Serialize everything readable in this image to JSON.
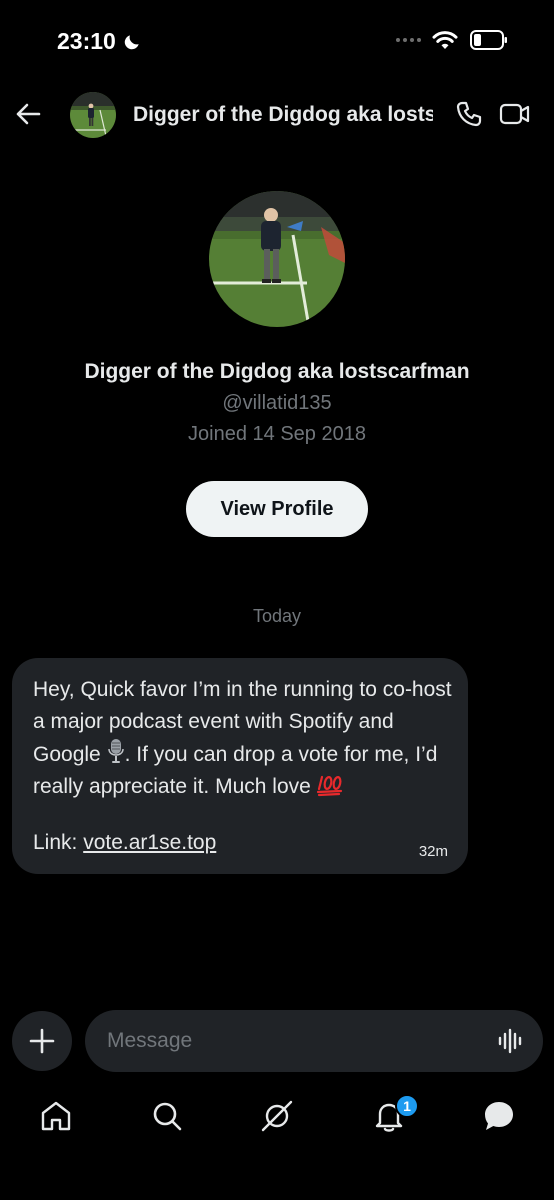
{
  "status_bar": {
    "time": "23:10",
    "icons": [
      "moon-icon",
      "signal-dots-icon",
      "wifi-icon",
      "battery-icon"
    ]
  },
  "header": {
    "title": "Digger of the Digdog aka lostscarfman",
    "icons": [
      "back-arrow-icon",
      "phone-icon",
      "video-camera-icon"
    ]
  },
  "profile": {
    "name": "Digger of the Digdog aka lostscarfman",
    "handle": "@villatid135",
    "joined": "Joined 14 Sep 2018",
    "view_profile_label": "View Profile"
  },
  "conversation": {
    "date_separator": "Today",
    "messages": [
      {
        "text_part1": "Hey, Quick favor I’m in the running to co-host a major podcast event with Spotify and Google ",
        "emoji1": "microphone-emoji",
        "text_part2": ". If you can drop a vote for me, I’d really appreciate it. Much love ",
        "emoji2": "hundred-points-emoji",
        "link_prefix": "Link: ",
        "link_text": "vote.ar1se.top",
        "time": "32m"
      }
    ]
  },
  "composer": {
    "placeholder": "Message",
    "icons": [
      "plus-icon",
      "voice-waveform-icon"
    ]
  },
  "bottom_nav": {
    "items": [
      "home-icon",
      "search-icon",
      "grok-icon",
      "notifications-icon",
      "messages-icon"
    ],
    "notification_count": "1"
  },
  "colors": {
    "background": "#000000",
    "bubble": "#202327",
    "text": "#e7e9ea",
    "muted": "#71767b",
    "accent": "#1d9bf0",
    "button": "#eff3f4"
  }
}
